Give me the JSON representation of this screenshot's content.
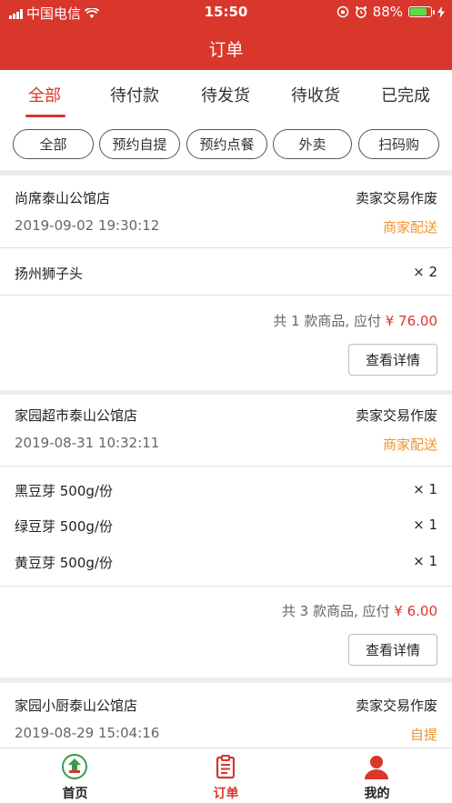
{
  "status_bar": {
    "carrier": "中国电信",
    "time": "15:50",
    "battery": "88%",
    "battery_level": 0.88,
    "icons": [
      "signal-icon",
      "wifi-icon",
      "rotation-lock-icon",
      "alarm-icon",
      "battery-icon",
      "charging-icon"
    ]
  },
  "header": {
    "title": "订单"
  },
  "tabs": [
    {
      "label": "全部",
      "active": true
    },
    {
      "label": "待付款"
    },
    {
      "label": "待发货"
    },
    {
      "label": "待收货"
    },
    {
      "label": "已完成"
    }
  ],
  "chips": [
    "全部",
    "预约自提",
    "预约点餐",
    "外卖",
    "扫码购"
  ],
  "orders": [
    {
      "store": "尚席泰山公馆店",
      "status": "卖家交易作废",
      "date": "2019-09-02 19:30:12",
      "delivery": "商家配送",
      "items": [
        {
          "name": "扬州狮子头",
          "qty": "× 2"
        }
      ],
      "summary_prefix": "共 1 款商品, 应付 ",
      "total": "¥ 76.00",
      "button": "查看详情"
    },
    {
      "store": "家园超市泰山公馆店",
      "status": "卖家交易作废",
      "date": "2019-08-31 10:32:11",
      "delivery": "商家配送",
      "items": [
        {
          "name": "黑豆芽 500g/份",
          "qty": "× 1"
        },
        {
          "name": "绿豆芽 500g/份",
          "qty": "× 1"
        },
        {
          "name": "黄豆芽 500g/份",
          "qty": "× 1"
        }
      ],
      "summary_prefix": "共 3 款商品, 应付 ",
      "total": "¥ 6.00",
      "button": "查看详情"
    },
    {
      "store": "家园小厨泰山公馆店",
      "status": "卖家交易作废",
      "date": "2019-08-29 15:04:16",
      "delivery": "自提"
    }
  ],
  "bottom_nav": [
    {
      "label": "首页",
      "icon": "home-logo-icon"
    },
    {
      "label": "订单",
      "icon": "clipboard-icon",
      "active": true
    },
    {
      "label": "我的",
      "icon": "user-icon"
    }
  ],
  "colors": {
    "brand": "#d9362c",
    "accent_orange": "#f0932f",
    "battery_green": "#5ddc4a"
  }
}
